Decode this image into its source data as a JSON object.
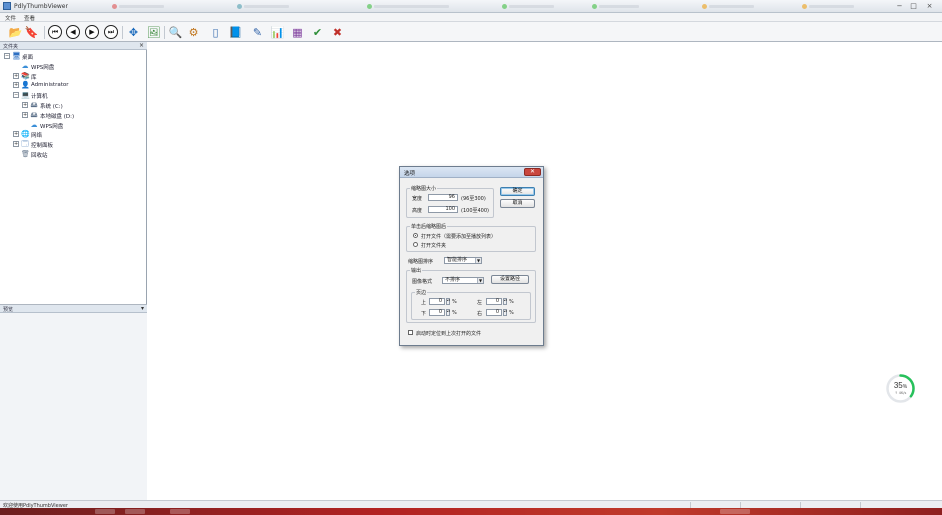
{
  "window": {
    "title": "PdlyThumbViewer"
  },
  "menu": [
    "文件",
    "查看"
  ],
  "toolbar": {
    "buttons": [
      {
        "name": "open-folder-icon",
        "glyph": "📂"
      },
      {
        "name": "bookmark-icon",
        "glyph": "🔖"
      },
      {
        "name": "first-button",
        "glyph": "⏮"
      },
      {
        "name": "prev-button",
        "glyph": "◀"
      },
      {
        "name": "next-button",
        "glyph": "▶"
      },
      {
        "name": "last-button",
        "glyph": "⏭"
      },
      {
        "name": "move-icon",
        "glyph": "✥"
      },
      {
        "name": "export-image-icon",
        "glyph": "🖼"
      },
      {
        "name": "search-icon",
        "glyph": "🔍"
      },
      {
        "name": "tools-icon",
        "glyph": "⚙"
      },
      {
        "name": "page-icon",
        "glyph": "▯"
      },
      {
        "name": "book-icon",
        "glyph": "📘"
      },
      {
        "name": "edit-icon",
        "glyph": "✎"
      },
      {
        "name": "chart-icon",
        "glyph": "📊"
      },
      {
        "name": "grid-icon",
        "glyph": "▦"
      },
      {
        "name": "check-icon",
        "glyph": "✔"
      },
      {
        "name": "delete-icon",
        "glyph": "✖"
      }
    ]
  },
  "sidebar": {
    "header": "文件夹",
    "lower_header": "预览",
    "tree": [
      {
        "label": "桌面",
        "icon": "🖥",
        "indent": 0,
        "exp": "−"
      },
      {
        "label": "WPS网盘",
        "icon": "☁",
        "indent": 1,
        "exp": ""
      },
      {
        "label": "库",
        "icon": "📚",
        "indent": 1,
        "exp": "+"
      },
      {
        "label": "Administrator",
        "icon": "👤",
        "indent": 1,
        "exp": "+"
      },
      {
        "label": "计算机",
        "icon": "💻",
        "indent": 1,
        "exp": "−"
      },
      {
        "label": "系统 (C:)",
        "icon": "🖴",
        "indent": 2,
        "exp": "+"
      },
      {
        "label": "本地磁盘 (D:)",
        "icon": "🖴",
        "indent": 2,
        "exp": "+"
      },
      {
        "label": "WPS网盘",
        "icon": "☁",
        "indent": 2,
        "exp": ""
      },
      {
        "label": "网络",
        "icon": "🌐",
        "indent": 1,
        "exp": "+"
      },
      {
        "label": "控制面板",
        "icon": "🗔",
        "indent": 1,
        "exp": "+"
      },
      {
        "label": "回收站",
        "icon": "🗑",
        "indent": 1,
        "exp": ""
      }
    ]
  },
  "dialog": {
    "title": "选项",
    "close": "✕",
    "size_group": "缩略图大小",
    "width_label": "宽度",
    "width_value": "96",
    "width_range": "(96至300)",
    "height_label": "高度",
    "height_value": "100",
    "height_range": "(100至400)",
    "ok_button": "确定",
    "cancel_button": "取消",
    "open_group": "单击后缩略图后",
    "open_option_1": "打开文件（需要添加至播放列表）",
    "open_option_2": "打开文件夹",
    "sort_label": "缩略图排序",
    "sort_value": "智能排序",
    "output_group": "输出",
    "image_format_label": "图像格式",
    "image_format_value": "不排序",
    "save_path_button": "设置路径",
    "margin_group": "页边",
    "margin_left_label": "上",
    "margin_left_value": "0",
    "margin_right_label": "左",
    "margin_right_value": "0",
    "margin_bottom_label": "下",
    "margin_bottom_value": "0",
    "margin_right2_label": "右",
    "margin_right2_value": "0",
    "unit": "%",
    "remember_label": "启动时定位到上次打开的文件"
  },
  "status": {
    "text": "欢迎使用PdlyThumbViewer"
  },
  "progress": {
    "percent": "35",
    "unit": "%",
    "sub": "↑ 4K/s",
    "fraction": 0.35,
    "color": "#27c15b"
  }
}
